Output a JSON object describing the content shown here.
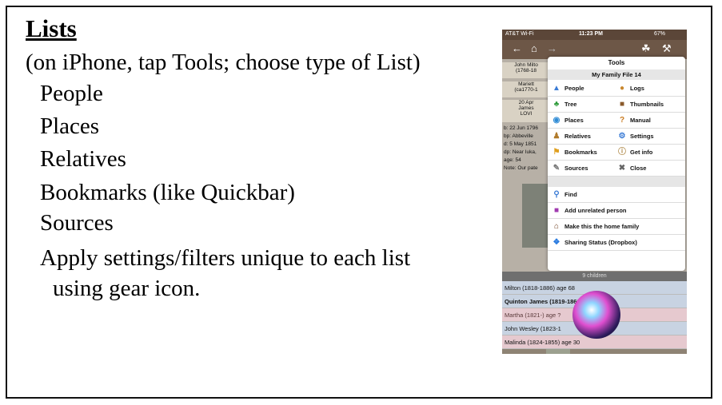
{
  "slide": {
    "title": "Lists",
    "subtitle": "(on iPhone, tap Tools; choose type of List)",
    "bullets": [
      "People",
      "Places",
      "Relatives",
      "Bookmarks (like Quickbar)",
      "Sources",
      "Apply settings/filters unique to each list"
    ],
    "continuation": "using gear icon."
  },
  "phone": {
    "status": {
      "carrier": "AT&T Wi-Fi",
      "time": "11:23 PM",
      "battery": "67%"
    },
    "background": {
      "card1": [
        "John Milto",
        "(1768-18"
      ],
      "card2": [
        "Mariett",
        "(ca1770-1"
      ],
      "card3": [
        "20 Apr",
        "James",
        "LOVI"
      ],
      "info": [
        "b: 22 Jun 1796",
        "bp: Abbeville",
        "d: 5 May 1851",
        "dp: Near Iuka,",
        "age: 54",
        "Note: Our pate"
      ]
    },
    "tools": {
      "title": "Tools",
      "file": "My Family File 14",
      "left": [
        {
          "label": "People",
          "icon": "people-icon"
        },
        {
          "label": "Tree",
          "icon": "tree-icon"
        },
        {
          "label": "Places",
          "icon": "globe-icon"
        },
        {
          "label": "Relatives",
          "icon": "relatives-icon"
        },
        {
          "label": "Bookmarks",
          "icon": "bookmark-icon"
        },
        {
          "label": "Sources",
          "icon": "source-icon"
        }
      ],
      "right": [
        {
          "label": "Logs",
          "icon": "logs-icon"
        },
        {
          "label": "Thumbnails",
          "icon": "thumbnails-icon"
        },
        {
          "label": "Manual",
          "icon": "manual-icon"
        },
        {
          "label": "Settings",
          "icon": "gear-icon"
        },
        {
          "label": "Get info",
          "icon": "info-icon"
        },
        {
          "label": "Close",
          "icon": "close-icon"
        }
      ],
      "actions": [
        {
          "label": "Find",
          "icon": "search-icon"
        },
        {
          "label": "Add unrelated person",
          "icon": "add-person-icon"
        },
        {
          "label": "Make this the home family",
          "icon": "home-icon"
        },
        {
          "label": "Sharing Status (Dropbox)",
          "icon": "dropbox-icon"
        }
      ]
    },
    "children_header": "9 children",
    "children": [
      "Milton (1818-1886) age 68",
      "Quinton James (1819-1862) age 43",
      "Martha (1821-) age ?",
      "John Wesley (1823-1",
      "Malinda (1824-1855) age 30"
    ],
    "colors": {
      "status_bar": "#5b4638",
      "nav_bar": "#6d5747",
      "accent_blue": "#3a7bd5"
    }
  }
}
